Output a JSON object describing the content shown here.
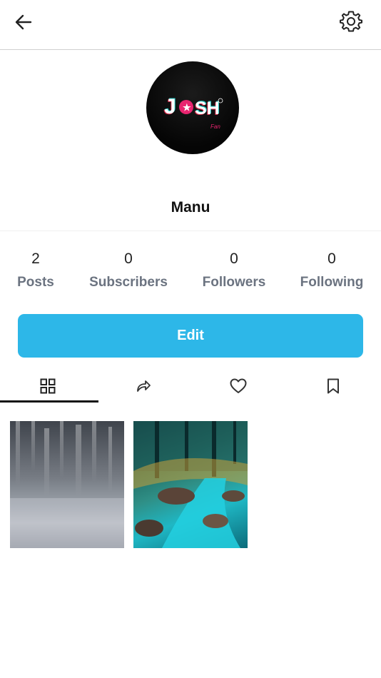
{
  "profile": {
    "username": "Manu",
    "avatar_logo_text": "JOSH",
    "avatar_logo_sub": "Fan"
  },
  "stats": [
    {
      "value": "2",
      "label": "Posts"
    },
    {
      "value": "0",
      "label": "Subscribers"
    },
    {
      "value": "0",
      "label": "Followers"
    },
    {
      "value": "0",
      "label": "Following"
    }
  ],
  "edit_button": {
    "label": "Edit"
  },
  "icons": {
    "back": "arrow-left-icon",
    "settings": "gear-icon",
    "tabs": [
      "grid-icon",
      "share-icon",
      "heart-icon",
      "bookmark-icon"
    ]
  },
  "tabs": {
    "active": "grid"
  },
  "colors": {
    "accent": "#2db7e8",
    "stat_label": "#6b7380"
  },
  "posts": [
    {
      "name": "post-thumbnail-1"
    },
    {
      "name": "post-thumbnail-2"
    }
  ]
}
